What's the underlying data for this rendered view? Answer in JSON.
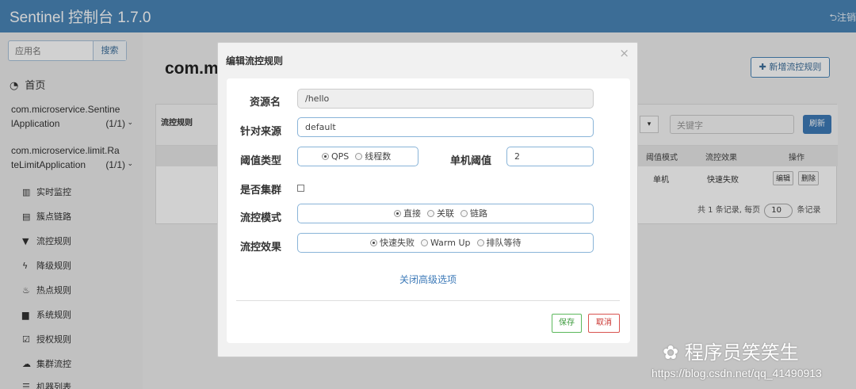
{
  "header": {
    "title": "Sentinel 控制台 1.7.0",
    "logout_label": "注销"
  },
  "sidebar": {
    "search_placeholder": "应用名",
    "search_button": "搜索",
    "home_label": "首页",
    "apps": [
      {
        "name_line1": "com.microservice.Sentine",
        "name_line2": "lApplication",
        "count": "(1/1)"
      },
      {
        "name_line1": "com.microservice.limit.Ra",
        "name_line2": "teLimitApplication",
        "count": "(1/1)"
      }
    ],
    "menu": [
      {
        "label": "实时监控",
        "icon": "bar-chart-icon"
      },
      {
        "label": "簇点链路",
        "icon": "list-icon"
      },
      {
        "label": "流控规则",
        "icon": "filter-icon"
      },
      {
        "label": "降级规则",
        "icon": "flash-icon"
      },
      {
        "label": "热点规则",
        "icon": "fire-icon"
      },
      {
        "label": "系统规则",
        "icon": "lock-icon"
      },
      {
        "label": "授权规则",
        "icon": "check-icon"
      },
      {
        "label": "集群流控",
        "icon": "cloud-icon"
      },
      {
        "label": "机器列表",
        "icon": "th-list-icon"
      }
    ]
  },
  "content": {
    "title": "com.m",
    "add_button": "新增流控规则",
    "panel_title": "流控规则",
    "keyword_placeholder": "关键字",
    "refresh_button": "刷新",
    "columns": {
      "mode": "阈值模式",
      "effect": "流控效果",
      "ops": "操作"
    },
    "row": {
      "mode": "单机",
      "effect": "快速失败",
      "edit": "编辑",
      "delete": "删除"
    },
    "pager": {
      "prefix": "共 1 条记录, 每页",
      "page_size": "10",
      "suffix": "条记录"
    }
  },
  "modal": {
    "title": "编辑流控规则",
    "close": "×",
    "resource_label": "资源名",
    "resource_value": "/hello",
    "origin_label": "针对来源",
    "origin_value": "default",
    "threshold_type_label": "阈值类型",
    "threshold_type_options": [
      "QPS",
      "线程数"
    ],
    "threshold_type_selected": "QPS",
    "single_threshold_label": "单机阈值",
    "single_threshold_value": "2",
    "cluster_label": "是否集群",
    "flow_mode_label": "流控模式",
    "flow_mode_options": [
      "直接",
      "关联",
      "链路"
    ],
    "flow_mode_selected": "直接",
    "flow_effect_label": "流控效果",
    "flow_effect_options": [
      "快速失败",
      "Warm Up",
      "排队等待"
    ],
    "flow_effect_selected": "快速失败",
    "advanced_link": "关闭高级选项",
    "save_button": "保存",
    "cancel_button": "取消"
  },
  "watermark": {
    "brand": "程序员笑笑生",
    "url": "https://blog.csdn.net/qq_41490913"
  }
}
